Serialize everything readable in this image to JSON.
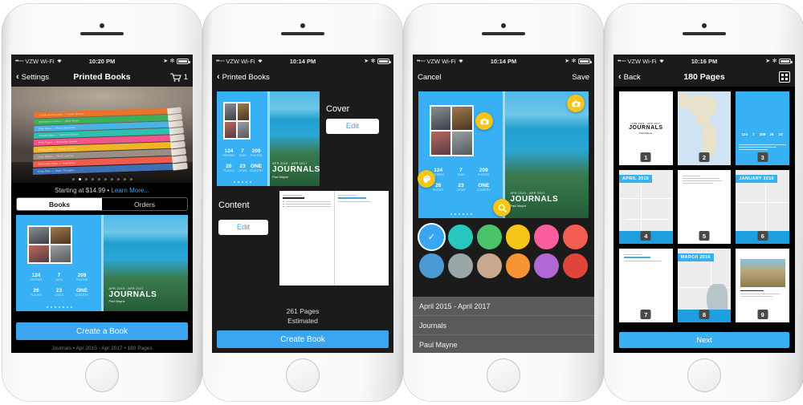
{
  "phones": [
    {
      "status": {
        "carrier": "VZW Wi-Fi",
        "signal_dots": "••◦◦◦",
        "time": "10:20 PM",
        "wifi": "wifi-icon"
      },
      "nav": {
        "back_label": "Settings",
        "title": "Printed Books",
        "cart_count": "1"
      },
      "promo": {
        "price_text": "Starting at $14.99 •",
        "learn_more": "Learn More..."
      },
      "segments": [
        {
          "label": "Books",
          "selected": true
        },
        {
          "label": "Orders",
          "selected": false
        }
      ],
      "carousel_dots": 10,
      "carousel_active": 1,
      "cover": {
        "kicker": "APR 2015 - APR 2017",
        "title": "JOURNALS",
        "author": "Paul Mayne",
        "stats": [
          {
            "value": "124",
            "label": "ENTRIES"
          },
          {
            "value": "7",
            "label": "TAGS"
          },
          {
            "value": "209",
            "label": "PHOTOS"
          },
          {
            "value": "26",
            "label": "PLACES"
          },
          {
            "value": "23",
            "label": "CITIES"
          },
          {
            "value": "ONE",
            "label": "COUNTRY"
          }
        ]
      },
      "cta_label": "Create a Book",
      "meta_line": "Journals  •  Apr 2015 - Apr 2017  •  180 Pages"
    },
    {
      "status": {
        "carrier": "VZW Wi-Fi",
        "signal_dots": "••◦◦◦",
        "time": "10:14 PM",
        "wifi": "wifi-icon"
      },
      "nav": {
        "back_label": "Printed Books",
        "title": "",
        "cart_count": ""
      },
      "sections": [
        {
          "label": "Cover",
          "button": "Edit"
        },
        {
          "label": "Content",
          "button": "Edit"
        }
      ],
      "pages_count": "261 Pages",
      "pages_note": "Estimated",
      "cta_label": "Create Book"
    },
    {
      "status": {
        "carrier": "VZW Wi-Fi",
        "signal_dots": "••◦◦◦",
        "time": "10:14 PM",
        "wifi": "wifi-icon"
      },
      "nav": {
        "cancel_label": "Cancel",
        "save_label": "Save"
      },
      "badges": [
        "camera-icon",
        "camera-icon",
        "color-icon",
        "search-icon"
      ],
      "swatches": [
        {
          "hex": "#3aa5f0",
          "selected": true
        },
        {
          "hex": "#28c7c0",
          "selected": false
        },
        {
          "hex": "#4cc26a",
          "selected": false
        },
        {
          "hex": "#f5c518",
          "selected": false
        },
        {
          "hex": "#f95d9b",
          "selected": false
        },
        {
          "hex": "#f45d52",
          "selected": false
        },
        {
          "hex": "#4a9bd4",
          "selected": false
        },
        {
          "hex": "#9aa7a8",
          "selected": false
        },
        {
          "hex": "#c9a98e",
          "selected": false
        },
        {
          "hex": "#f79434",
          "selected": false
        },
        {
          "hex": "#b268d4",
          "selected": false
        },
        {
          "hex": "#e0453a",
          "selected": false
        }
      ],
      "fields": [
        {
          "name": "date-range-field",
          "value": "April 2015 - April 2017"
        },
        {
          "name": "title-field",
          "value": "Journals"
        },
        {
          "name": "author-field",
          "value": "Paul Mayne"
        }
      ]
    },
    {
      "status": {
        "carrier": "VZW Wi-Fi",
        "signal_dots": "••◦◦◦",
        "time": "10:16 PM",
        "wifi": "wifi-icon"
      },
      "nav": {
        "back_label": "Back",
        "title": "180 Pages",
        "grid_icon": "grid-view-icon"
      },
      "thumbnails": [
        {
          "number": "1",
          "kind": "title",
          "kicker": "APR 2015 - APR 2017",
          "title": "JOURNALS",
          "sub": "Paul Mayne"
        },
        {
          "number": "2",
          "kind": "map-americas",
          "label": ""
        },
        {
          "number": "3",
          "kind": "blue-stats",
          "label": ""
        },
        {
          "number": "4",
          "kind": "map-date",
          "label": "APRIL 2015"
        },
        {
          "number": "5",
          "kind": "text",
          "label": ""
        },
        {
          "number": "6",
          "kind": "map-date",
          "label": "JANUARY 2016"
        },
        {
          "number": "7",
          "kind": "text",
          "label": ""
        },
        {
          "number": "8",
          "kind": "map-date",
          "label": "MARCH 2016"
        },
        {
          "number": "9",
          "kind": "photo-entry",
          "label": ""
        }
      ],
      "cta_label": "Next"
    }
  ]
}
